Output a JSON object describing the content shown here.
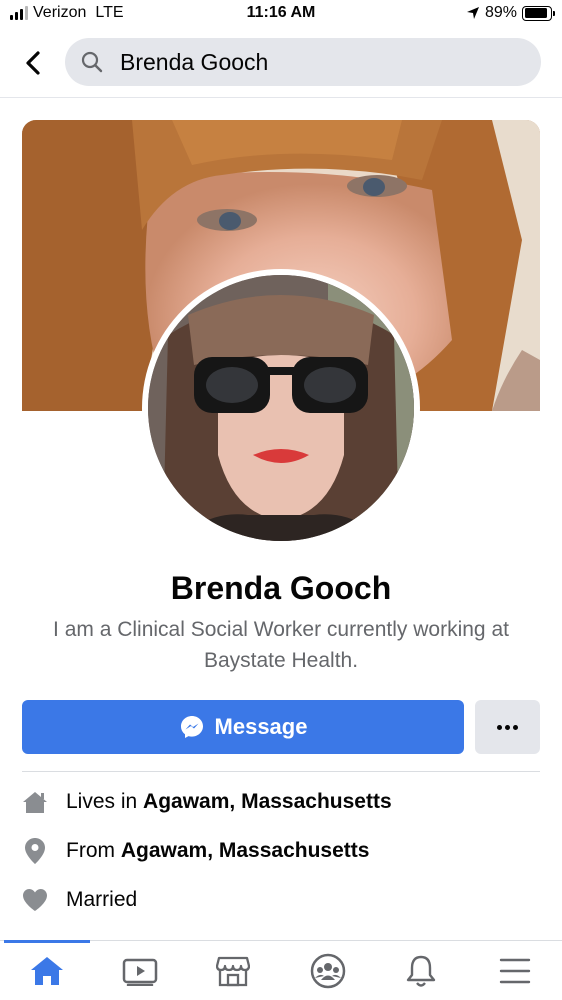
{
  "status_bar": {
    "carrier": "Verizon",
    "network": "LTE",
    "time": "11:16 AM",
    "battery_percent": "89%",
    "battery_level": 0.89
  },
  "search": {
    "query": "Brenda Gooch"
  },
  "profile": {
    "name": "Brenda Gooch",
    "bio": "I am a Clinical Social Worker currently working at Baystate Health."
  },
  "actions": {
    "message_label": "Message"
  },
  "info": [
    {
      "prefix": "Lives in",
      "value": "Agawam, Massachusetts",
      "icon": "home-icon"
    },
    {
      "prefix": "From",
      "value": "Agawam, Massachusetts",
      "icon": "location-pin-icon"
    },
    {
      "prefix": "Married",
      "value": "",
      "icon": "heart-icon"
    }
  ],
  "tabs": [
    {
      "icon": "home-icon",
      "active": true
    },
    {
      "icon": "watch-icon",
      "active": false
    },
    {
      "icon": "marketplace-icon",
      "active": false
    },
    {
      "icon": "groups-icon",
      "active": false
    },
    {
      "icon": "notifications-icon",
      "active": false
    },
    {
      "icon": "menu-icon",
      "active": false
    }
  ],
  "colors": {
    "accent": "#3b78e7",
    "secondary_text": "#65676b",
    "icon_gray": "#8a8d91"
  }
}
